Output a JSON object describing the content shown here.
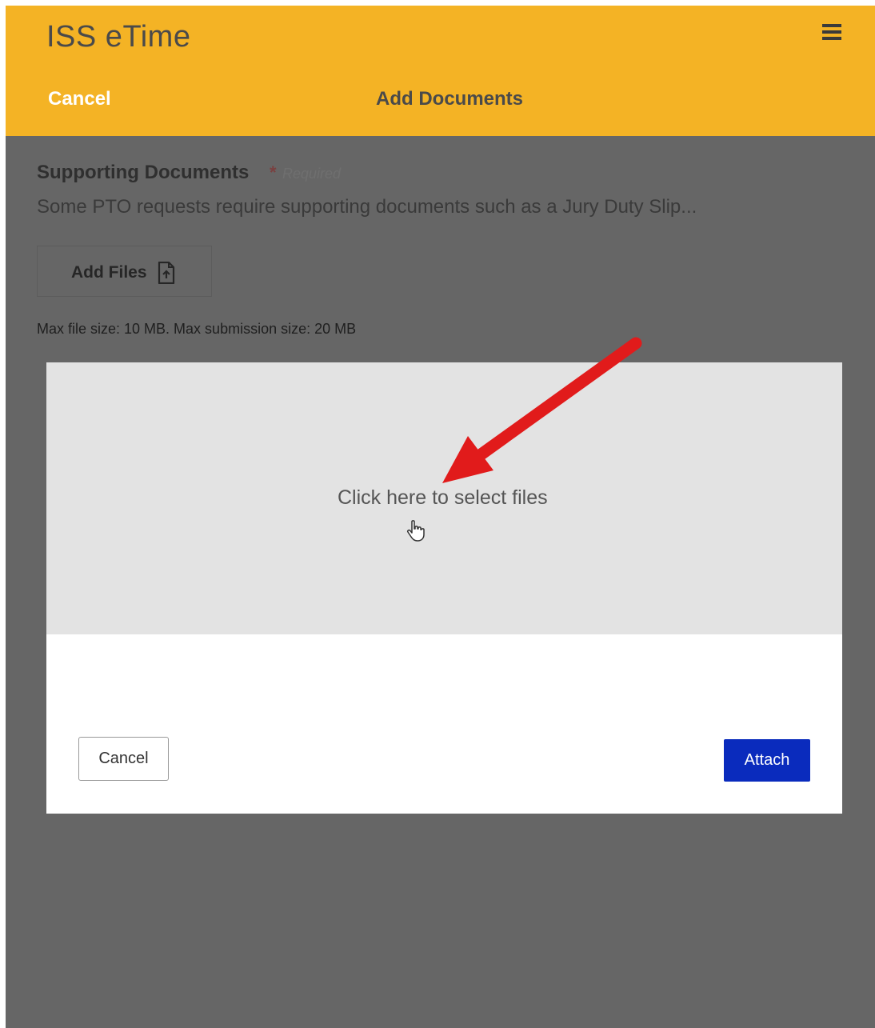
{
  "header": {
    "app_title": "ISS eTime",
    "cancel_label": "Cancel",
    "page_title": "Add Documents",
    "menu_icon": "hamburger-menu-icon"
  },
  "supporting_documents": {
    "title": "Supporting Documents",
    "required_marker": "*",
    "required_text": "Required",
    "description": "Some PTO requests require supporting documents such as a Jury Duty Slip...",
    "add_files_label": "Add Files",
    "add_files_icon": "file-upload-icon",
    "limits_text": "Max file size: 10 MB. Max submission size: 20 MB"
  },
  "file_dialog": {
    "dropzone_text": "Click here to select files",
    "cursor_icon": "hand-pointer-icon",
    "cancel_label": "Cancel",
    "attach_label": "Attach"
  },
  "colors": {
    "header_bg": "#f4b325",
    "overlay_bg": "#666666",
    "dropzone_bg": "#e3e3e3",
    "attach_button": "#0a2bbd",
    "annotation_arrow": "#e11b1b"
  }
}
